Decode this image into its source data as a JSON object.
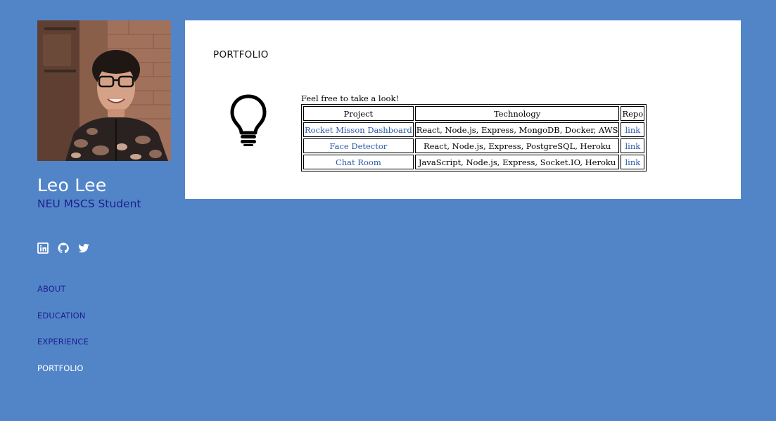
{
  "profile": {
    "name": "Leo Lee",
    "subtitle": "NEU MSCS Student"
  },
  "social": [
    {
      "icon": "linkedin-icon"
    },
    {
      "icon": "github-icon"
    },
    {
      "icon": "twitter-icon"
    }
  ],
  "nav": {
    "items": [
      {
        "label": "ABOUT"
      },
      {
        "label": "EDUCATION"
      },
      {
        "label": "EXPERIENCE"
      },
      {
        "label": "PORTFOLIO"
      }
    ],
    "active": "PORTFOLIO"
  },
  "portfolio": {
    "title": "PORTFOLIO",
    "icon": "lightbulb-icon",
    "intro": "Feel free to take a look!",
    "table": {
      "headers": [
        "Project",
        "Technology",
        "Repo"
      ],
      "rows": [
        {
          "project": "Rocket Misson Dashboard",
          "technology": "React, Node.js, Express, MongoDB, Docker, AWS",
          "repo": "link"
        },
        {
          "project": "Face Detector",
          "technology": "React, Node.js, Express, PostgreSQL, Heroku",
          "repo": "link"
        },
        {
          "project": "Chat Room",
          "technology": "JavaScript, Node.js, Express, Socket.IO, Heroku",
          "repo": "link"
        }
      ]
    }
  },
  "colors": {
    "background": "#5285c8",
    "card": "#ffffff",
    "nav_text": "#1d1f8e",
    "link": "#2a58a8"
  }
}
